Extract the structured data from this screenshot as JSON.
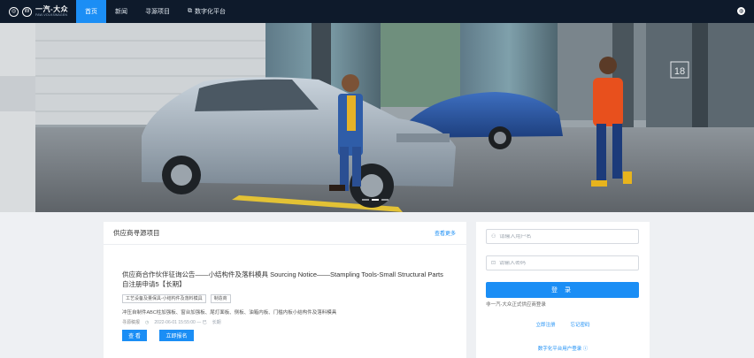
{
  "nav": {
    "logo_cn": "一汽-大众",
    "logo_en": "FAW-VOLKSWAGEN",
    "items": [
      {
        "label": "首页",
        "active": true
      },
      {
        "label": "新闻",
        "active": false
      },
      {
        "label": "寻源项目",
        "active": false
      },
      {
        "label": "数字化平台",
        "active": false
      }
    ]
  },
  "banner": {
    "building_number": "18",
    "slide_count": 3,
    "active_slide": 2
  },
  "sourcing": {
    "title": "供应商寻源项目",
    "more_label": "查看更多",
    "notice": {
      "title": "供应商合作伙伴征询公告——小结构件及落料模具 Sourcing Notice——Stampling Tools-Small Structural Parts自注册申请5【长期】",
      "tags": [
        "工艺设备及量保具-小结构件及落料模具",
        "制造商"
      ],
      "description": "冲压自制件ABC柱加强板、窗台加强板、尾灯面板、侧板、油箱内板、门槛内板小结构件及落料模具",
      "meta_label": "寻源稿报",
      "time": "2022-06-01 15:55:00 — 已",
      "status": "长期",
      "view_button": "查 看",
      "apply_button": "立即报名"
    }
  },
  "login": {
    "username_placeholder": "请输入用户名",
    "password_placeholder": "请输入密码",
    "login_button": "登 录",
    "hint": "非一汽-大众正式供应商登录",
    "register_link": "立即注册",
    "forgot_link": "忘记密码",
    "digital_login": "数字化平台用户登录"
  },
  "colors": {
    "accent": "#1b8ef5",
    "topbar": "#0e1a2b"
  }
}
